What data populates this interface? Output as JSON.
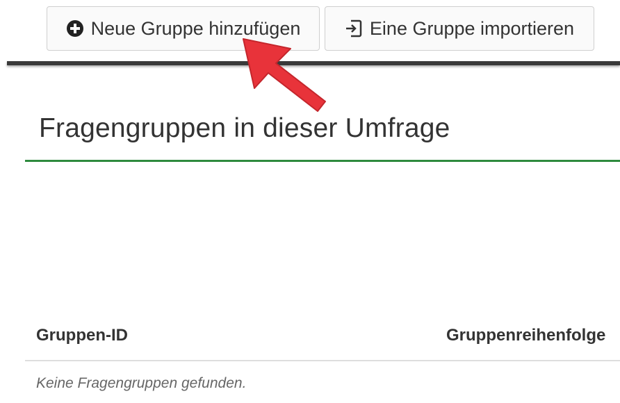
{
  "toolbar": {
    "add_group_label": "Neue Gruppe hinzufügen",
    "add_group_icon": "plus-circle-icon",
    "import_group_label": "Eine Gruppe importieren",
    "import_group_icon": "import-icon"
  },
  "annotation": {
    "arrow_icon": "red-arrow-pointer",
    "arrow_color": "#e8333a"
  },
  "section": {
    "title": "Fragengruppen in dieser Umfrage",
    "accent_color": "#2e8b3e"
  },
  "table": {
    "columns": [
      "Gruppen-ID",
      "Gruppenreihenfolge"
    ],
    "empty_message": "Keine Fragengruppen gefunden."
  }
}
